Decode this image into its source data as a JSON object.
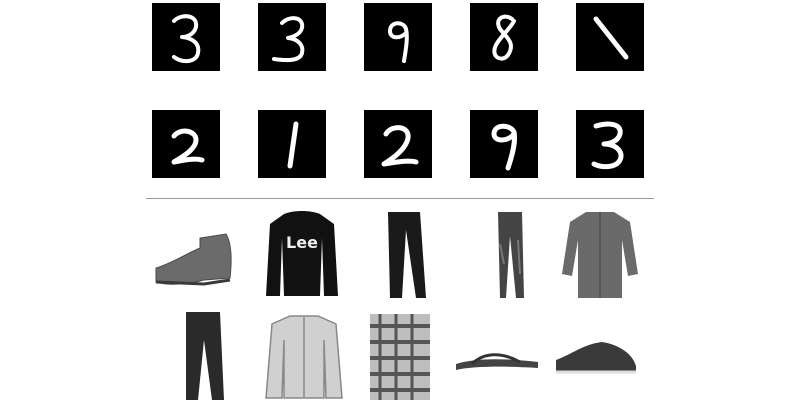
{
  "mnist_digits": [
    {
      "label": "3"
    },
    {
      "label": "3"
    },
    {
      "label": "9"
    },
    {
      "label": "8"
    },
    {
      "label": "1"
    },
    {
      "label": "2"
    },
    {
      "label": "1"
    },
    {
      "label": "2"
    },
    {
      "label": "9"
    },
    {
      "label": "3"
    }
  ],
  "fashion_items": [
    {
      "kind": "ankle-boot"
    },
    {
      "kind": "pullover",
      "print": "Lee"
    },
    {
      "kind": "trouser"
    },
    {
      "kind": "trouser"
    },
    {
      "kind": "shirt"
    },
    {
      "kind": "trouser"
    },
    {
      "kind": "pullover"
    },
    {
      "kind": "shirt"
    },
    {
      "kind": "sandal"
    },
    {
      "kind": "sneaker"
    }
  ],
  "colors": {
    "tile_background": "#000000",
    "digit_stroke": "#ffffff",
    "divider": "#9a9a9a"
  }
}
